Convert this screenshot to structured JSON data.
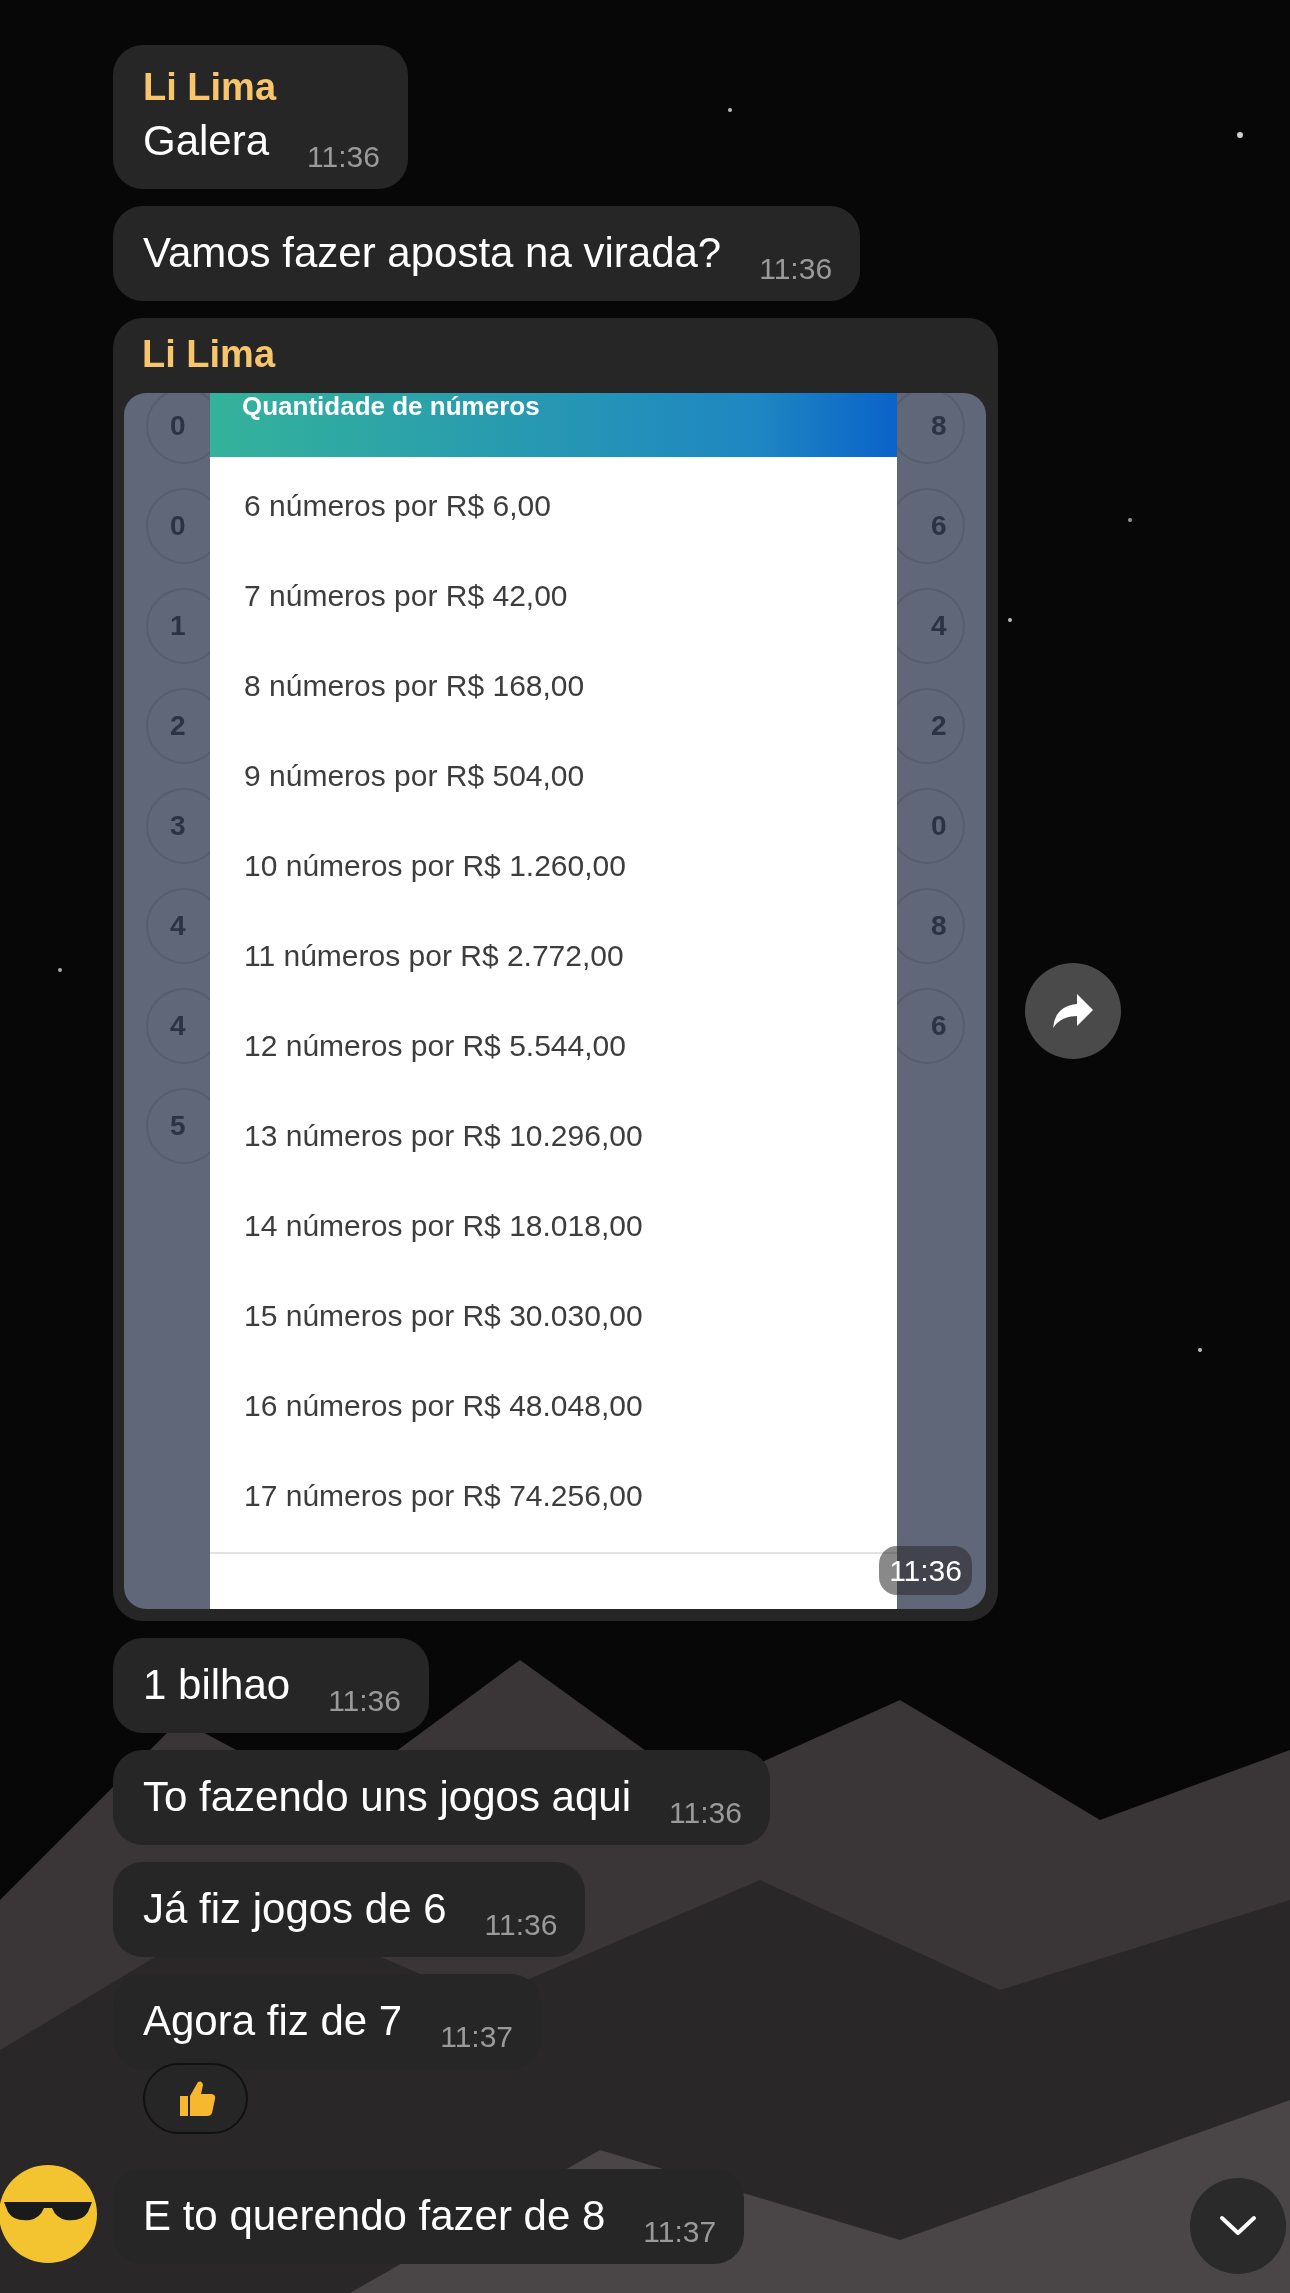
{
  "messages": [
    {
      "kind": "text",
      "sender": "Li Lima",
      "text": "Galera",
      "time": "11:36",
      "reacted": false,
      "avatar": false
    },
    {
      "kind": "text",
      "text": "Vamos fazer aposta na virada?",
      "time": "11:36",
      "reacted": false,
      "avatar": false
    },
    {
      "sender": "Li Lima",
      "time": "11:36",
      "screenshot": {
        "header": "Quantidade de números",
        "options": [
          "6 números por R$ 6,00",
          "7 números por R$ 42,00",
          "8 números por R$ 168,00",
          "9 números por R$ 504,00",
          "10 números por R$ 1.260,00",
          "11 números por R$ 2.772,00",
          "12 números por R$ 5.544,00",
          "13 números por R$ 10.296,00",
          "14 números por R$ 18.018,00",
          "15 números por R$ 30.030,00",
          "16 números por R$ 48.048,00",
          "17 números por R$ 74.256,00"
        ],
        "left_numbers": [
          "0",
          "0",
          "1",
          "2",
          "3",
          "4",
          "4",
          "5"
        ],
        "right_numbers": [
          "8",
          "6",
          "4",
          "2",
          "0",
          "8",
          "6"
        ]
      }
    },
    {
      "kind": "text",
      "text": "1 bilhao",
      "time": "11:36",
      "reacted": false,
      "avatar": false
    },
    {
      "kind": "text",
      "text": "To fazendo uns jogos aqui",
      "time": "11:36",
      "reacted": false,
      "avatar": false
    },
    {
      "kind": "text",
      "text": "Já fiz jogos de 6",
      "time": "11:36",
      "reacted": false,
      "avatar": false
    },
    {
      "kind": "text",
      "text": "Agora fiz de 7",
      "time": "11:37",
      "reacted": true,
      "avatar": false
    },
    {
      "kind": "text",
      "text": "E to querendo fazer de 8",
      "time": "11:37",
      "reacted": false,
      "avatar": true
    }
  ]
}
